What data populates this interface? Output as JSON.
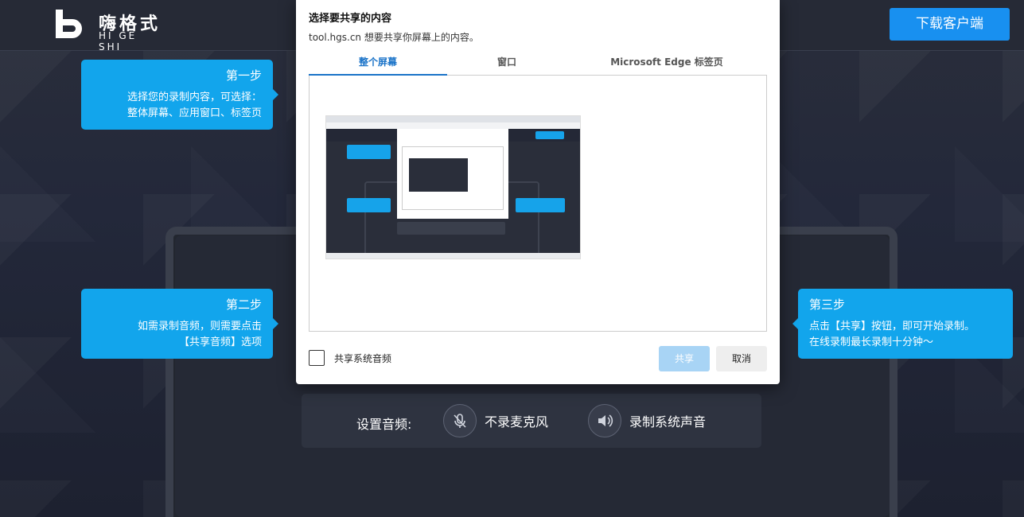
{
  "header": {
    "logo_cn": "嗨格式",
    "logo_en": "HI GE SHI",
    "download_label": "下载客户端"
  },
  "tips": {
    "step1": {
      "title": "第一步",
      "line1": "选择您的录制内容，可选择：",
      "line2": "整体屏幕、应用窗口、标签页"
    },
    "step2": {
      "title": "第二步",
      "line1": "如需录制音频，则需要点击",
      "line2": "【共享音频】选项"
    },
    "step3": {
      "title": "第三步",
      "line1": "点击【共享】按钮，即可开始录制。",
      "line2": "在线录制最长录制十分钟～"
    }
  },
  "audio": {
    "label": "设置音频:",
    "mic_label": "不录麦克风",
    "system_label": "录制系统声音"
  },
  "dialog": {
    "title": "选择要共享的内容",
    "subtitle": "tool.hgs.cn 想要共享你屏幕上的内容。",
    "tabs": [
      "整个屏幕",
      "窗口",
      "Microsoft Edge 标签页"
    ],
    "active_tab": 0,
    "share_audio_label": "共享系统音频",
    "share_button": "共享",
    "cancel_button": "取消"
  },
  "colors": {
    "accent": "#1890f0",
    "tip_blue": "#12a5ec",
    "tab_active": "#1a73c8"
  }
}
